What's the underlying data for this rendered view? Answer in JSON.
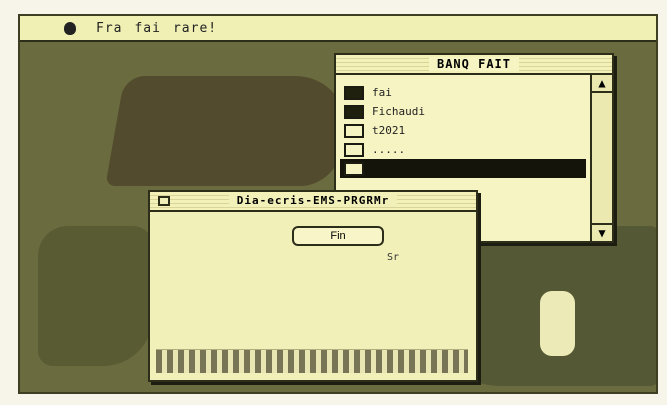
{
  "menu": {
    "items": [
      "Fra",
      "fai",
      "rare!"
    ]
  },
  "directory_window": {
    "title": "BANQ FAIT",
    "files": [
      {
        "name": "fai"
      },
      {
        "name": "Fichaudi"
      },
      {
        "name": "t2021"
      },
      {
        "name": "....."
      },
      {
        "name": ""
      }
    ],
    "scroll_up": "▲",
    "scroll_down": "▼"
  },
  "dialog": {
    "title": "Dia-ecris-EMS-PRGRMr",
    "button_label": "Fin",
    "cursor_text": "Sr"
  }
}
